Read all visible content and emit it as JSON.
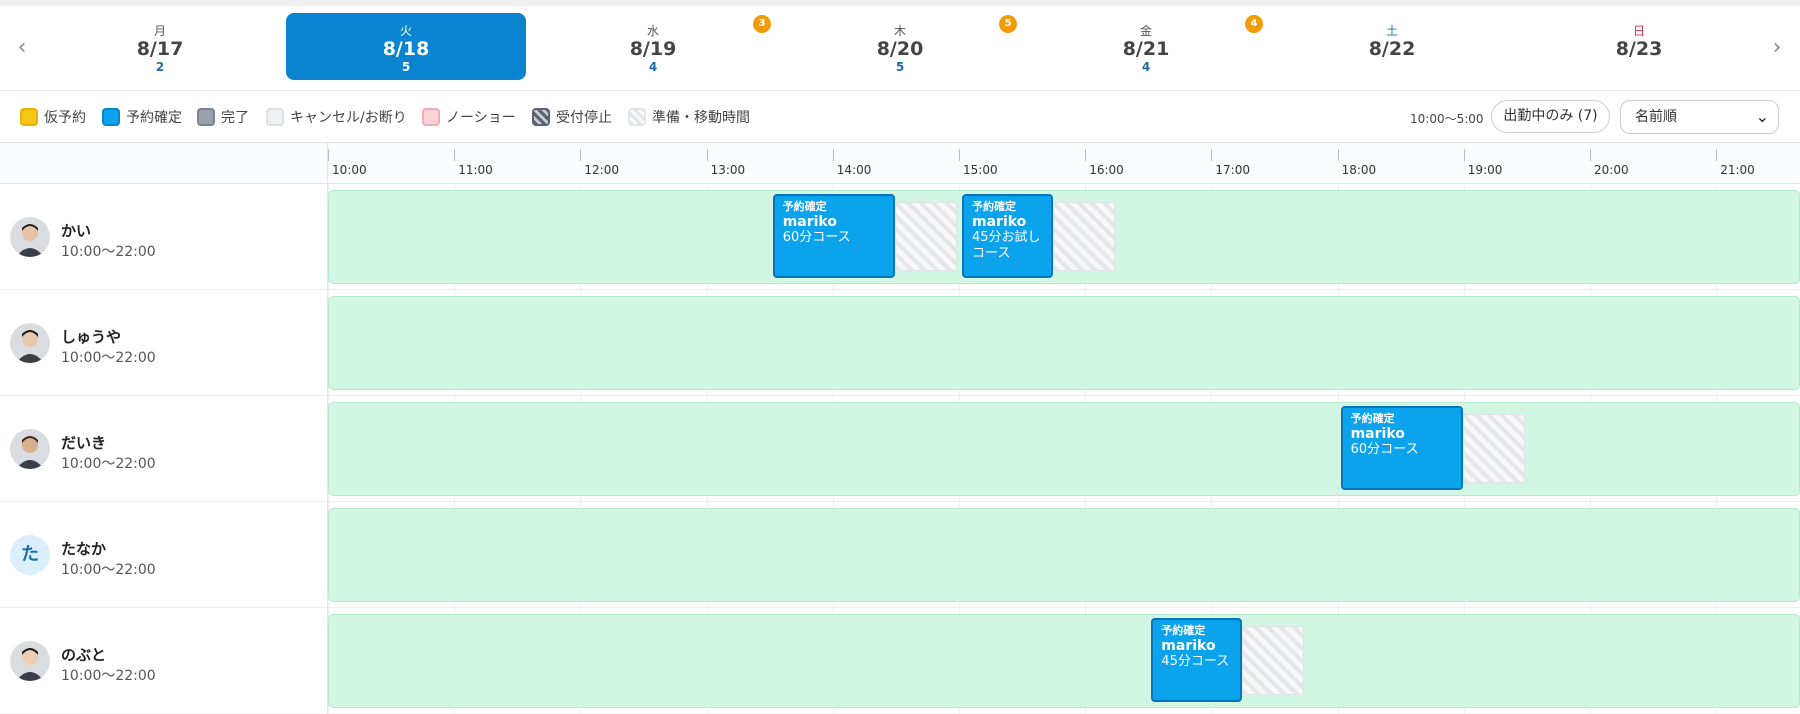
{
  "week": {
    "days": [
      {
        "dow": "月",
        "date": "8/17",
        "count": "2"
      },
      {
        "dow": "火",
        "date": "8/18",
        "count": "5"
      },
      {
        "dow": "水",
        "date": "8/19",
        "count": "4"
      },
      {
        "dow": "木",
        "date": "8/20",
        "count": "5"
      },
      {
        "dow": "金",
        "date": "8/21",
        "count": "4"
      },
      {
        "dow": "土",
        "date": "8/22",
        "count": ""
      },
      {
        "dow": "日",
        "date": "8/23",
        "count": ""
      }
    ],
    "badges": [
      "3",
      "5",
      "4"
    ],
    "prev_icon": "‹",
    "next_icon": "›"
  },
  "legend": {
    "items": [
      "仮予約",
      "予約確定",
      "完了",
      "キャンセル/お断り",
      "ノーショー",
      "受付停止",
      "準備・移動時間"
    ],
    "colors": {
      "tentative": "#f5c518",
      "confirmed": "#0ba3ec",
      "completed": "#9aa1ad",
      "cancelled": "#eef0f3",
      "noshow": "#ffd3d8"
    },
    "hours": "10:00〜5:00",
    "filter_label": "出勤中のみ (7)",
    "sort_label": "名前順"
  },
  "timeline": {
    "hours": [
      "10:00",
      "11:00",
      "12:00",
      "13:00",
      "14:00",
      "15:00",
      "16:00",
      "17:00",
      "18:00",
      "19:00",
      "20:00",
      "21:00"
    ]
  },
  "staff": [
    {
      "name": "かい",
      "hours": "10:00〜22:00"
    },
    {
      "name": "しゅうや",
      "hours": "10:00〜22:00"
    },
    {
      "name": "だいき",
      "hours": "10:00〜22:00"
    },
    {
      "name": "たなか",
      "hours": "10:00〜22:00",
      "initial": "た"
    },
    {
      "name": "のぶと",
      "hours": "10:00〜22:00"
    }
  ],
  "bookings": [
    {
      "status": "予約確定",
      "client": "mariko",
      "course": "60分コース"
    },
    {
      "status": "予約確定",
      "client": "mariko",
      "course": "45分お試し",
      "course2": "コース"
    },
    {
      "status": "予約確定",
      "client": "mariko",
      "course": "60分コース"
    },
    {
      "status": "予約確定",
      "client": "mariko",
      "course": "45分コース"
    }
  ]
}
